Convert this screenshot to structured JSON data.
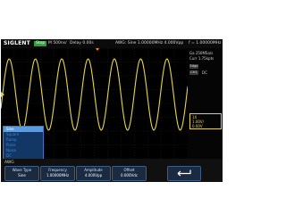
{
  "header": {
    "brand": "SIGLENT",
    "state": "Stop",
    "timebase": "M 500ns/",
    "delay": "Delay 0.00s",
    "awg_summary": "AWG: Sine 1.00000MHz 4.000Vpp",
    "frequency_readout": "f = 1.00000MHz"
  },
  "right_panel": {
    "sample_rate": "Ga 250MSa/s",
    "memory_depth": "Curr 1.75kpts",
    "trigger_type_badge": "Edge",
    "trigger_source_badge": "CH1",
    "trigger_slope": "DC",
    "ch1": {
      "coupling": "1X",
      "scale": "1.00V/",
      "offset": "0.00V"
    }
  },
  "waveform_menu": {
    "items": [
      "Sine",
      "Square",
      "Ramp",
      "Pulse",
      "Noise",
      "DC",
      "Arb"
    ],
    "selected_index": 0
  },
  "bottom": {
    "title": "AWG",
    "softkeys": [
      {
        "label": "Wave Type",
        "value": "Sine"
      },
      {
        "label": "Frequency",
        "value": "1.00000MHz"
      },
      {
        "label": "Amplitude",
        "value": "4.000Vpp"
      },
      {
        "label": "Offset",
        "value": "0.000Vdc"
      }
    ],
    "return_icon": "return-arrow-icon"
  },
  "colors": {
    "ch1_trace": "#e6d645",
    "menu_background": "#123765",
    "menu_selected": "#5a9ce0",
    "state_badge": "#2aa136"
  }
}
